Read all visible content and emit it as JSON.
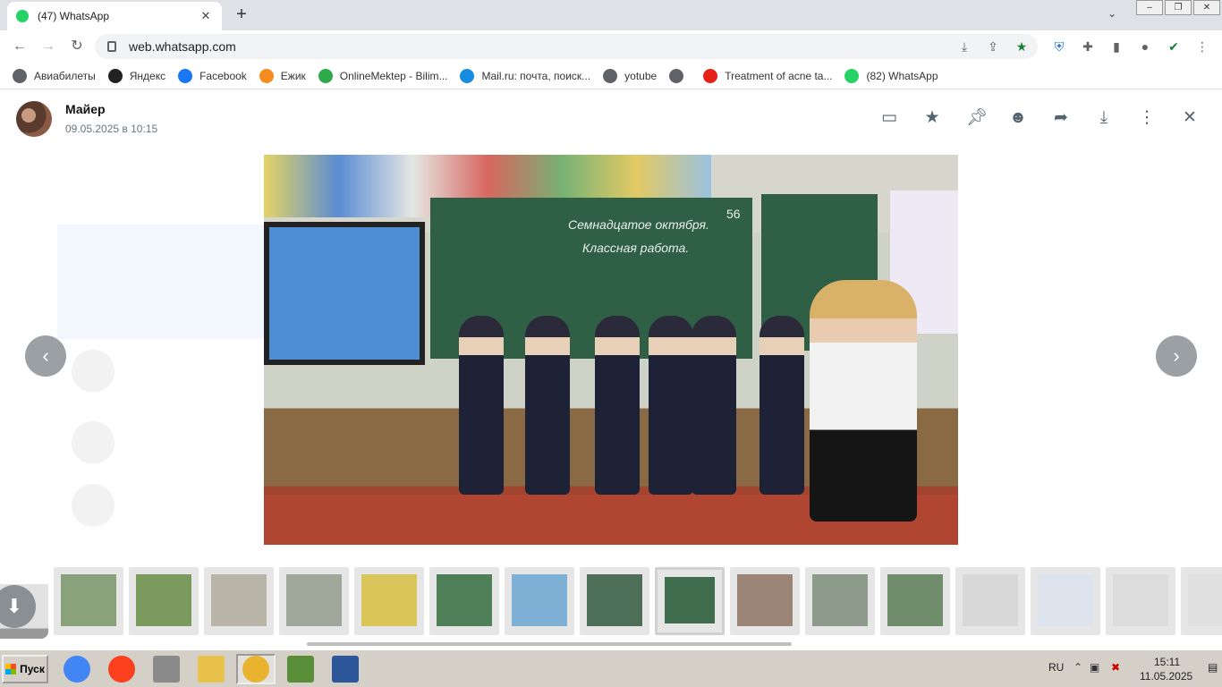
{
  "browser": {
    "tab_title": "(47) WhatsApp",
    "tab_close": "✕",
    "new_tab": "+",
    "tab_search": "⌄",
    "window_buttons": [
      "–",
      "❐",
      "✕"
    ],
    "url": "web.whatsapp.com"
  },
  "bookmarks": [
    {
      "label": "Авиабилеты",
      "color": "#5f6368"
    },
    {
      "label": "Яндекс",
      "color": "#222222"
    },
    {
      "label": "Facebook",
      "color": "#1877f2"
    },
    {
      "label": "Ежик",
      "color": "#f68b1f"
    },
    {
      "label": "OnlineMektep - Bilim...",
      "color": "#2eaa4b"
    },
    {
      "label": "Mail.ru: почта, поиск...",
      "color": "#168de2"
    },
    {
      "label": "yotube",
      "color": "#5f6368"
    },
    {
      "label": "",
      "color": "#5f6368"
    },
    {
      "label": "Treatment of acne ta...",
      "color": "#e62117"
    },
    {
      "label": "(82) WhatsApp",
      "color": "#25d366"
    }
  ],
  "viewer": {
    "sender": "Майер",
    "sent_at": "09.05.2025 в 10:15",
    "prev": "‹",
    "next": "›",
    "download": "⬇"
  },
  "photo": {
    "board_text_1": "Семнадцатое октября.",
    "board_text_2": "Классная работа.",
    "board_number": "56"
  },
  "thumbnails": {
    "count": 16,
    "selected_index": 8,
    "colors": [
      "#8aa27c",
      "#7a9a5e",
      "#b9b4a8",
      "#9fa89a",
      "#d9c55a",
      "#4f7f56",
      "#7fb0d6",
      "#4d6f57",
      "#3f6d4e",
      "#9b8577",
      "#8c9b8a",
      "#6f8d6a",
      "#d8d8d8",
      "#dde4ee",
      "#dcdcdc",
      "#e0e0e0"
    ]
  },
  "taskbar": {
    "start_label": "Пуск",
    "apps": [
      {
        "name": "chrome",
        "color": "#4285f4"
      },
      {
        "name": "yandex",
        "color": "#fc3f1d"
      },
      {
        "name": "printer",
        "color": "#8a8a8a"
      },
      {
        "name": "explorer",
        "color": "#e8c24a"
      },
      {
        "name": "keys",
        "color": "#e9b32f"
      },
      {
        "name": "checker",
        "color": "#5a8f3a"
      },
      {
        "name": "word",
        "color": "#2b579a"
      }
    ],
    "language": "RU",
    "time": "15:11",
    "date": "11.05.2025"
  }
}
